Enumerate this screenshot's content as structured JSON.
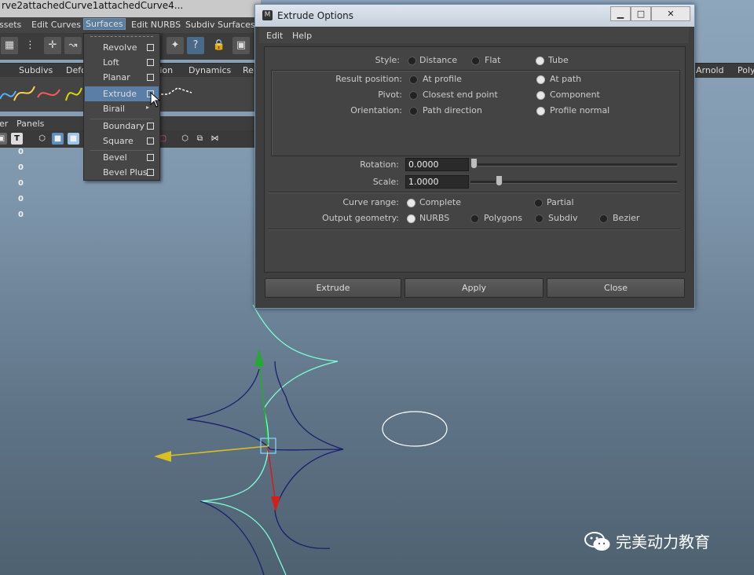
{
  "window": {
    "title": "rve2attachedCurve1attachedCurve4..."
  },
  "main_menu": {
    "items": [
      "ssets",
      "Edit Curves",
      "Surfaces",
      "Edit NURBS",
      "Subdiv Surfaces"
    ]
  },
  "shelf_tabs": {
    "left": [
      "Subdivs",
      "Defo",
      "tion",
      "Dynamics",
      "Re"
    ],
    "right": [
      "Arnold",
      "Poly"
    ]
  },
  "panel_menu": {
    "items": [
      "er",
      "Panels"
    ]
  },
  "channel_values": [
    "0",
    "0",
    "0",
    "0",
    "0",
    "0"
  ],
  "surfaces_menu": {
    "items": [
      {
        "label": "Revolve"
      },
      {
        "label": "Loft"
      },
      {
        "label": "Planar"
      },
      {
        "label": "Extrude",
        "highlighted": true
      },
      {
        "label": "Birail",
        "submenu": true
      },
      {
        "label": "Boundary"
      },
      {
        "label": "Square"
      },
      {
        "label": "Bevel"
      },
      {
        "label": "Bevel Plus"
      }
    ]
  },
  "dialog": {
    "title": "Extrude Options",
    "menu": [
      "Edit",
      "Help"
    ],
    "style": {
      "label": "Style:",
      "options": [
        "Distance",
        "Flat",
        "Tube"
      ],
      "selected": "Tube"
    },
    "result_position": {
      "label": "Result position:",
      "options": [
        "At profile",
        "At path"
      ],
      "selected": "At path"
    },
    "pivot": {
      "label": "Pivot:",
      "options": [
        "Closest end point",
        "Component"
      ],
      "selected": "Component"
    },
    "orientation": {
      "label": "Orientation:",
      "options": [
        "Path direction",
        "Profile normal"
      ],
      "selected": "Profile normal"
    },
    "rotation": {
      "label": "Rotation:",
      "value": "0.0000",
      "slider_fraction": 0.0
    },
    "scale": {
      "label": "Scale:",
      "value": "1.0000",
      "slider_fraction": 0.12
    },
    "curve_range": {
      "label": "Curve range:",
      "options": [
        "Complete",
        "Partial"
      ],
      "selected": "Complete"
    },
    "output_geometry": {
      "label": "Output geometry:",
      "options": [
        "NURBS",
        "Polygons",
        "Subdiv",
        "Bezier"
      ],
      "selected": "NURBS"
    },
    "buttons": {
      "extrude": "Extrude",
      "apply": "Apply",
      "close": "Close"
    },
    "window_buttons": {
      "minimize": "▁",
      "maximize": "□",
      "close": "✕"
    }
  },
  "watermark": {
    "text": "完美动力教育"
  },
  "colors": {
    "viewport_top": "#8ea6bc",
    "viewport_bottom": "#4e6171",
    "menu_highlight": "#5b7ea6",
    "curve_cyan": "#7fffd4",
    "curve_navy": "#1a1f6e",
    "axis_y": "#22aa33",
    "axis_x": "#d8c020",
    "axis_z": "#d0201c"
  }
}
